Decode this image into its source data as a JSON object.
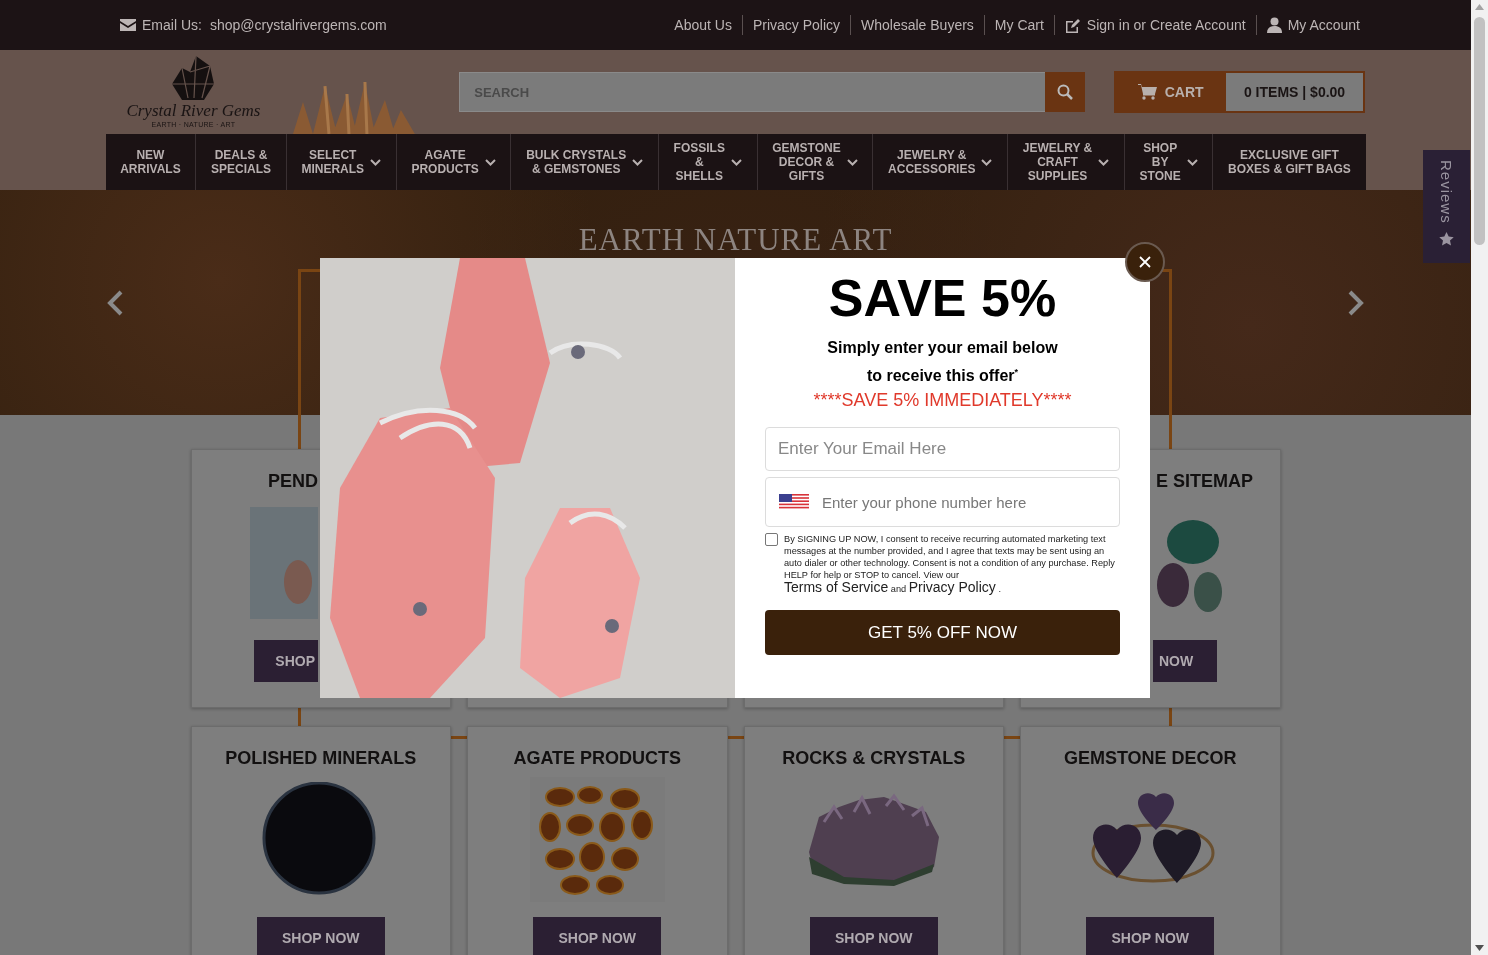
{
  "top_bar": {
    "email_label": "Email Us:",
    "email": "shop@crystalrivergems.com",
    "links": [
      {
        "label": "About Us"
      },
      {
        "label": "Privacy Policy"
      },
      {
        "label": "Wholesale Buyers"
      },
      {
        "label": "My Cart"
      },
      {
        "label": "Sign in or Create Account"
      },
      {
        "label": "My Account"
      }
    ]
  },
  "logo": {
    "name": "Crystal River Gems",
    "tagline": "EARTH · NATURE · ART"
  },
  "search": {
    "placeholder": "SEARCH"
  },
  "cart": {
    "label": "CART",
    "summary": "0 ITEMS | $0.00"
  },
  "nav": [
    {
      "label": "NEW\nARRIVALS",
      "has_menu": false
    },
    {
      "label": "DEALS &\nSPECIALS",
      "has_menu": false
    },
    {
      "label": "SELECT\nMINERALS",
      "has_menu": true
    },
    {
      "label": "AGATE\nPRODUCTS",
      "has_menu": true
    },
    {
      "label": "BULK CRYSTALS\n& GEMSTONES",
      "has_menu": true
    },
    {
      "label": "FOSSILS\n&\nSHELLS",
      "has_menu": true
    },
    {
      "label": "GEMSTONE\nDECOR &\nGIFTS",
      "has_menu": true
    },
    {
      "label": "JEWELRY &\nACCESSORIES",
      "has_menu": true
    },
    {
      "label": "JEWELRY &\nCRAFT\nSUPPLIES",
      "has_menu": true
    },
    {
      "label": "SHOP\nBY\nSTONE",
      "has_menu": true
    },
    {
      "label": "EXCLUSIVE GIFT\nBOXES & GIFT BAGS",
      "has_menu": false
    }
  ],
  "hero": {
    "title": "EARTH NATURE ART"
  },
  "categories": [
    {
      "title": "PEND",
      "button": "SHOP"
    },
    {
      "title": "E SITEMAP",
      "button": "NOW"
    },
    {
      "title": "POLISHED MINERALS",
      "button": "SHOP NOW"
    },
    {
      "title": "AGATE PRODUCTS",
      "button": "SHOP NOW"
    },
    {
      "title": "ROCKS & CRYSTALS",
      "button": "SHOP NOW"
    },
    {
      "title": "GEMSTONE DECOR",
      "button": "SHOP NOW"
    }
  ],
  "reviews_tab": {
    "label": "Reviews"
  },
  "modal": {
    "title": "SAVE 5%",
    "subtitle": "Simply enter your email below\nto receive this offer$^{*}$",
    "promo": "****SAVE 5% IMMEDIATELY****",
    "email_placeholder": "Enter Your Email Here",
    "phone_placeholder": "Enter your phone number here",
    "consent": {
      "checked": false,
      "text": "By SIGNING UP NOW, I consent to receive recurring automated marketing text messages at the number provided, and I agree that texts may be sent using an auto dialer or other technology. Consent is not a condition of any purchase. Reply HELP for help or STOP to cancel. View our",
      "terms_link": "Terms of Service",
      "joiner": "and",
      "privacy_link": "Privacy Policy",
      "end": "."
    },
    "submit": "GET 5% OFF NOW"
  }
}
